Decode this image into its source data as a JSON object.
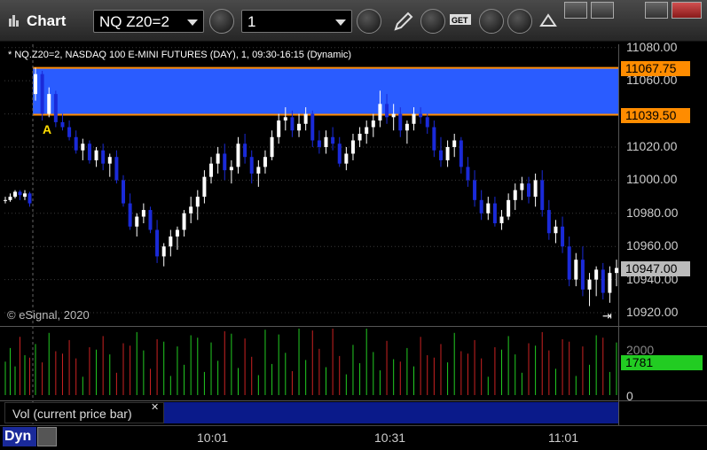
{
  "window": {
    "title": "Chart"
  },
  "toolbar": {
    "symbol": "NQ Z20=2",
    "interval": "1"
  },
  "chart_header": "* NQ.Z20=2, NASDAQ 100 E-MINI FUTURES (DAY), 1, 09:30-16:15 (Dynamic)",
  "copyright": "© eSignal, 2020",
  "annotation_label": "A",
  "price_axis": {
    "ticks": [
      "11080.00",
      "11060.00",
      "11040.00",
      "11020.00",
      "11000.00",
      "10980.00",
      "10960.00",
      "10940.00",
      "10920.00"
    ]
  },
  "price_tags": [
    {
      "value": "11067.75",
      "color": "#ff8c00"
    },
    {
      "value": "11039.50",
      "color": "#ff8c00"
    },
    {
      "value": "10947.00",
      "color": "#bbbbbb"
    }
  ],
  "volume": {
    "label": "Vol (current price bar)",
    "value": "1781",
    "axis_ticks": [
      "2000",
      "0"
    ]
  },
  "time_axis": [
    "10:01",
    "10:31",
    "11:01"
  ],
  "footer": {
    "mode": "Dyn"
  },
  "colors": {
    "up": "#ffffff",
    "down": "#1a2ad8",
    "zone": "#2a5cff",
    "zone_border": "#ff8c00",
    "vol_up": "#22cc22",
    "vol_down": "#cc2222"
  },
  "chart_data": {
    "type": "candlestick",
    "ylim": [
      10912,
      11082
    ],
    "zone": {
      "top": 11067.75,
      "bottom": 11039.5
    },
    "bars": [
      [
        10988,
        10990,
        10986,
        10988
      ],
      [
        10988,
        10992,
        10987,
        10990
      ],
      [
        10990,
        10994,
        10989,
        10993
      ],
      [
        10993,
        10994,
        10988,
        10991
      ],
      [
        10990,
        10994,
        10988,
        10992
      ],
      [
        10992,
        10993,
        10984,
        10986
      ],
      [
        11052,
        11068,
        11048,
        11064
      ],
      [
        11064,
        11066,
        11036,
        11040
      ],
      [
        11040,
        11056,
        11038,
        11052
      ],
      [
        11052,
        11054,
        11032,
        11035
      ],
      [
        11035,
        11040,
        11030,
        11032
      ],
      [
        11032,
        11036,
        11024,
        11026
      ],
      [
        11026,
        11030,
        11016,
        11018
      ],
      [
        11018,
        11025,
        11012,
        11022
      ],
      [
        11022,
        11024,
        11010,
        11012
      ],
      [
        11012,
        11020,
        11008,
        11018
      ],
      [
        11018,
        11022,
        11006,
        11010
      ],
      [
        11010,
        11016,
        11002,
        11014
      ],
      [
        11014,
        11018,
        10998,
        11000
      ],
      [
        11000,
        11003,
        10984,
        10986
      ],
      [
        10986,
        10992,
        10970,
        10972
      ],
      [
        10972,
        10980,
        10966,
        10978
      ],
      [
        10978,
        10986,
        10974,
        10982
      ],
      [
        10982,
        10984,
        10968,
        10970
      ],
      [
        10970,
        10976,
        10950,
        10954
      ],
      [
        10954,
        10962,
        10948,
        10960
      ],
      [
        10960,
        10970,
        10954,
        10966
      ],
      [
        10966,
        10972,
        10958,
        10970
      ],
      [
        10970,
        10982,
        10966,
        10980
      ],
      [
        10980,
        10990,
        10974,
        10984
      ],
      [
        10984,
        10994,
        10976,
        10990
      ],
      [
        10990,
        11006,
        10986,
        11002
      ],
      [
        11002,
        11014,
        10998,
        11010
      ],
      [
        11010,
        11020,
        11004,
        11016
      ],
      [
        11016,
        11022,
        11000,
        11006
      ],
      [
        11006,
        11012,
        10998,
        11008
      ],
      [
        11008,
        11026,
        11004,
        11022
      ],
      [
        11022,
        11028,
        11010,
        11014
      ],
      [
        11014,
        11018,
        10998,
        11004
      ],
      [
        11004,
        11012,
        10996,
        11008
      ],
      [
        11008,
        11018,
        11004,
        11014
      ],
      [
        11014,
        11030,
        11012,
        11026
      ],
      [
        11026,
        11040,
        11022,
        11036
      ],
      [
        11036,
        11044,
        11030,
        11038
      ],
      [
        11038,
        11042,
        11026,
        11030
      ],
      [
        11030,
        11040,
        11026,
        11034
      ],
      [
        11034,
        11044,
        11030,
        11040
      ],
      [
        11040,
        11042,
        11020,
        11024
      ],
      [
        11024,
        11030,
        11016,
        11020
      ],
      [
        11020,
        11030,
        11016,
        11026
      ],
      [
        11026,
        11032,
        11018,
        11022
      ],
      [
        11022,
        11026,
        11008,
        11010
      ],
      [
        11010,
        11020,
        11006,
        11016
      ],
      [
        11016,
        11028,
        11012,
        11024
      ],
      [
        11024,
        11032,
        11020,
        11028
      ],
      [
        11028,
        11036,
        11022,
        11032
      ],
      [
        11032,
        11040,
        11026,
        11036
      ],
      [
        11036,
        11054,
        11032,
        11046
      ],
      [
        11046,
        11052,
        11034,
        11038
      ],
      [
        11038,
        11046,
        11030,
        11040
      ],
      [
        11040,
        11044,
        11026,
        11030
      ],
      [
        11030,
        11036,
        11022,
        11034
      ],
      [
        11034,
        11044,
        11030,
        11040
      ],
      [
        11040,
        11044,
        11034,
        11038
      ],
      [
        11038,
        11040,
        11028,
        11032
      ],
      [
        11032,
        11036,
        11014,
        11018
      ],
      [
        11018,
        11026,
        11008,
        11012
      ],
      [
        11012,
        11024,
        11008,
        11020
      ],
      [
        11020,
        11028,
        11014,
        11024
      ],
      [
        11024,
        11026,
        11004,
        11008
      ],
      [
        11008,
        11014,
        10996,
        11000
      ],
      [
        11000,
        11006,
        10984,
        10988
      ],
      [
        10988,
        10994,
        10976,
        10980
      ],
      [
        10980,
        10990,
        10976,
        10986
      ],
      [
        10986,
        10990,
        10972,
        10974
      ],
      [
        10974,
        10982,
        10970,
        10978
      ],
      [
        10978,
        10992,
        10976,
        10988
      ],
      [
        10988,
        10998,
        10982,
        10994
      ],
      [
        10994,
        11002,
        10988,
        10998
      ],
      [
        10998,
        11002,
        10986,
        10990
      ],
      [
        10990,
        11004,
        10984,
        11000
      ],
      [
        11000,
        11006,
        10978,
        10982
      ],
      [
        10982,
        10988,
        10964,
        10968
      ],
      [
        10968,
        10976,
        10962,
        10972
      ],
      [
        10972,
        10978,
        10956,
        10960
      ],
      [
        10960,
        10966,
        10936,
        10940
      ],
      [
        10940,
        10956,
        10936,
        10952
      ],
      [
        10952,
        10960,
        10930,
        10934
      ],
      [
        10934,
        10944,
        10924,
        10940
      ],
      [
        10940,
        10948,
        10930,
        10946
      ],
      [
        10946,
        10950,
        10928,
        10932
      ],
      [
        10932,
        10948,
        10926,
        10944
      ],
      [
        10944,
        10952,
        10936,
        10947
      ]
    ]
  }
}
